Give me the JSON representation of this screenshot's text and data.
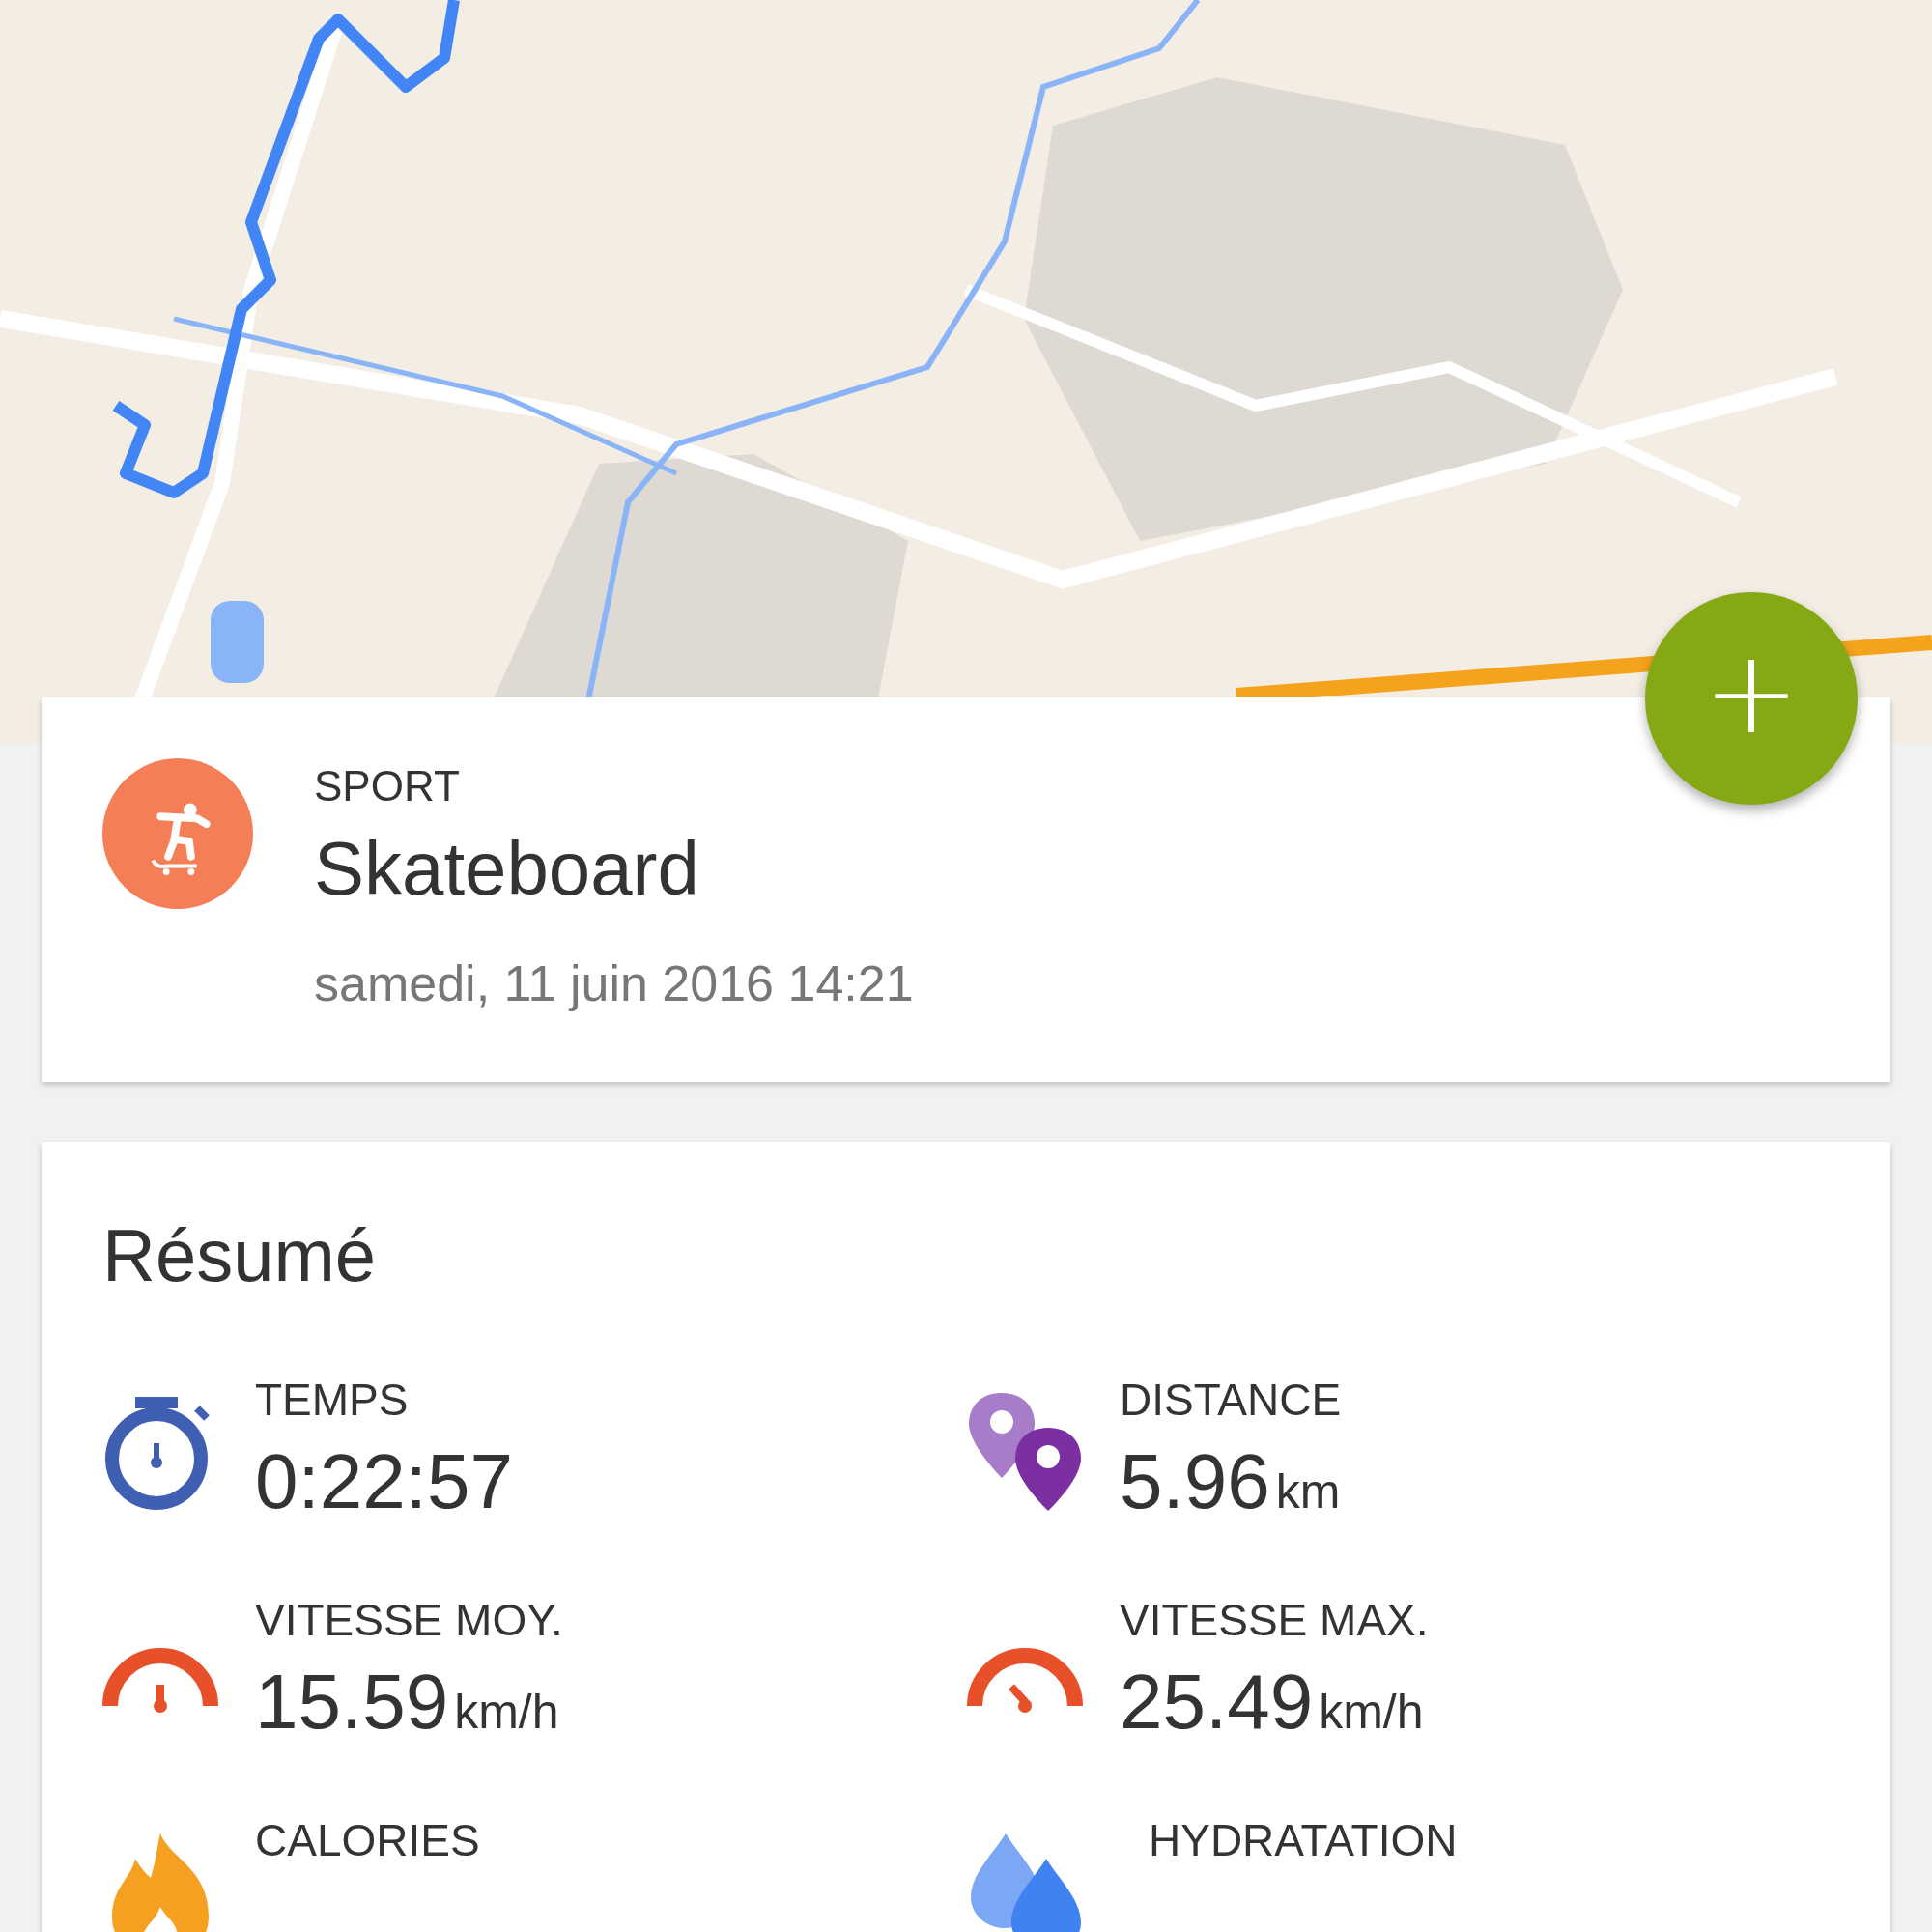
{
  "fab": {
    "label": "+"
  },
  "activity": {
    "category": "SPORT",
    "name": "Skateboard",
    "date": "samedi, 11 juin 2016 14:21"
  },
  "summary": {
    "title": "Résumé",
    "stats": [
      {
        "kind": "time",
        "label": "TEMPS",
        "value": "0:22:57"
      },
      {
        "kind": "distance",
        "label": "DISTANCE",
        "value": "5.96",
        "unit": "km"
      },
      {
        "kind": "avg_speed",
        "label": "VITESSE MOY.",
        "value": "15.59",
        "unit": "km/h"
      },
      {
        "kind": "max_speed",
        "label": "VITESSE MAX.",
        "value": "25.49",
        "unit": "km/h"
      },
      {
        "kind": "calories",
        "label": "CALORIES"
      },
      {
        "kind": "hydration",
        "label": "HYDRATATION"
      }
    ]
  }
}
